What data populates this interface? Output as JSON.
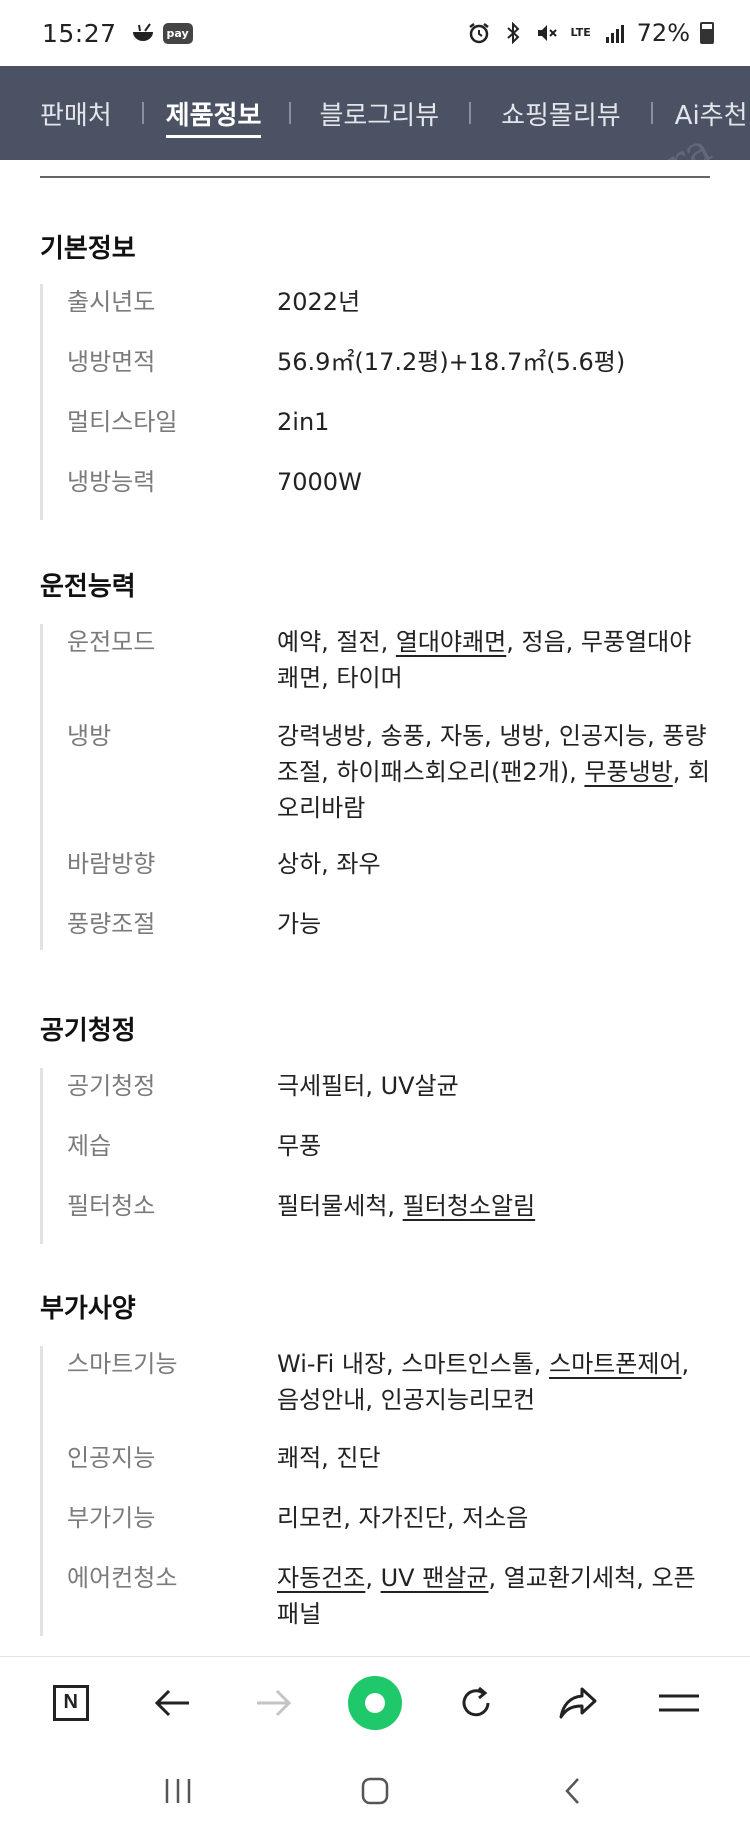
{
  "status_bar": {
    "time": "15:27",
    "pay_badge": "pay",
    "lte_label": "LTE",
    "battery_percent": "72%",
    "battery_level": 0.72
  },
  "tabs": [
    {
      "label": "판매처",
      "active": false
    },
    {
      "label": "제품정보",
      "active": true
    },
    {
      "label": "블로그리뷰",
      "active": false
    },
    {
      "label": "쇼핑몰리뷰",
      "active": false
    },
    {
      "label": "Ai추천",
      "active": false
    }
  ],
  "watermark": "danara",
  "sections": [
    {
      "title": "기본정보",
      "rows": [
        {
          "key": "출시년도",
          "value": "2022년"
        },
        {
          "key": "냉방면적",
          "value": "56.9㎡(17.2평)+18.7㎡(5.6평)"
        },
        {
          "key": "멀티스타일",
          "value": "2in1"
        },
        {
          "key": "냉방능력",
          "value": "7000W"
        }
      ]
    },
    {
      "title": "운전능력",
      "rows": [
        {
          "key": "운전모드",
          "parts": [
            "예약, 절전, ",
            "열대야쾌면",
            ", 정음, 무풍열대야쾌면, 타이머"
          ]
        },
        {
          "key": "냉방",
          "parts": [
            "강력냉방, 송풍, 자동, 냉방, 인공지능, 풍량조절, 하이패스회오리(팬2개), ",
            "무풍냉방",
            ", 회오리바람"
          ]
        },
        {
          "key": "바람방향",
          "value": "상하, 좌우"
        },
        {
          "key": "풍량조절",
          "value": "가능"
        }
      ]
    },
    {
      "title": "공기청정",
      "rows": [
        {
          "key": "공기청정",
          "value": "극세필터, UV살균"
        },
        {
          "key": "제습",
          "value": "무풍"
        },
        {
          "key": "필터청소",
          "parts": [
            "필터물세척, ",
            "필터청소알림",
            ""
          ]
        }
      ]
    },
    {
      "title": "부가사양",
      "rows": [
        {
          "key": "스마트기능",
          "parts": [
            "Wi-Fi 내장, 스마트인스톨, ",
            "스마트폰제어",
            ", 음성안내, 인공지능리모컨"
          ]
        },
        {
          "key": "인공지능",
          "value": "쾌적, 진단"
        },
        {
          "key": "부가기능",
          "value": "리모컨, 자가진단, 저소음"
        },
        {
          "key": "에어컨청소",
          "parts": [
            "",
            "자동건조",
            ", ",
            "UV 팬살균",
            ", 열교환기세척, 오픈패널"
          ]
        }
      ]
    }
  ],
  "toolbar": {
    "home_letter": "N"
  }
}
